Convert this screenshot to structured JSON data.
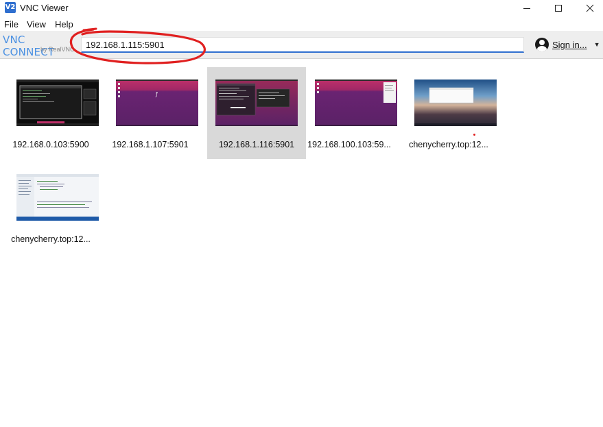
{
  "window": {
    "title": "VNC Viewer",
    "icon_text": "V2",
    "controls": [
      "minimize",
      "maximize",
      "close"
    ]
  },
  "menu": {
    "items": [
      "File",
      "View",
      "Help"
    ]
  },
  "toolbar": {
    "logo_main": "VNC CONNECT",
    "logo_sub": "by RealVNC",
    "address_value": "192.168.1.115:5901",
    "sign_in_label": "Sign in..."
  },
  "connections": [
    {
      "label": "192.168.0.103:5900",
      "thumbnail": "dark-terminal-desktop",
      "selected": false
    },
    {
      "label": "192.168.1.107:5901",
      "thumbnail": "ubuntu-purple-desktop",
      "selected": false
    },
    {
      "label": "192.168.1.116:5901",
      "thumbnail": "ubuntu-desktop-with-terminal",
      "selected": true
    },
    {
      "label": "192.168.100.103:59...",
      "thumbnail": "ubuntu-purple-desktop",
      "selected": false
    },
    {
      "label": "chenycherry.top:12...",
      "thumbnail": "lake-sunset-desktop",
      "selected": false
    },
    {
      "label": "chenycherry.top:12...",
      "thumbnail": "ide-editor-window",
      "selected": false
    }
  ],
  "colors": {
    "accent": "#2f6fcf",
    "annotation": "#e02020",
    "selected_tile": "#d9d9d9",
    "toolbar_bg": "#eeeeee"
  },
  "icons": {
    "app": "vnc-viewer-icon",
    "account": "user-avatar-icon",
    "dropdown": "chevron-down-icon"
  }
}
